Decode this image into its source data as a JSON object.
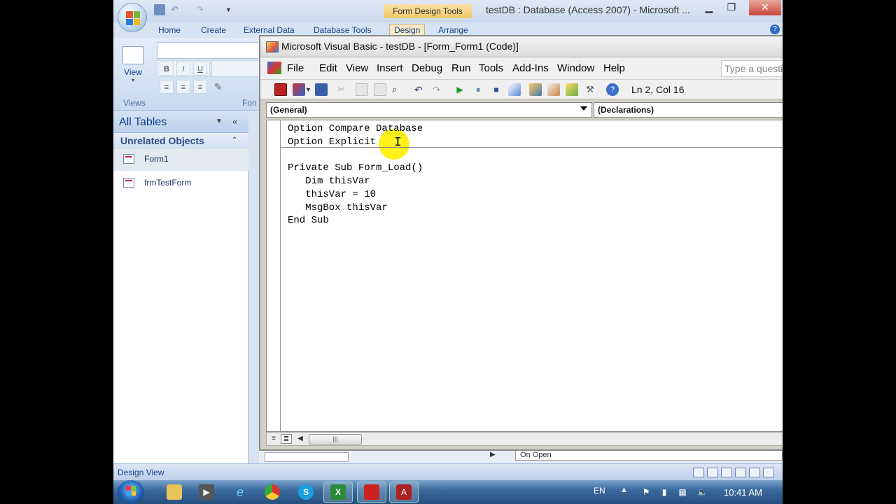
{
  "access": {
    "context_tab": "Form Design Tools",
    "title": "testDB : Database (Access 2007) - Microsoft ...",
    "tabs": [
      "Home",
      "Create",
      "External Data",
      "Database Tools",
      "Design",
      "Arrange"
    ],
    "view_label": "View",
    "views_group": "Views",
    "font_group_partial": "Fon",
    "format_buttons": [
      "B",
      "I",
      "U"
    ],
    "status_text": "Design View",
    "property_row": "On Open"
  },
  "nav_pane": {
    "title": "All Tables",
    "group": "Unrelated Objects",
    "items": [
      "Form1",
      "frmTestForm"
    ]
  },
  "vbe": {
    "title": "Microsoft Visual Basic - testDB - [Form_Form1 (Code)]",
    "menu": [
      "File",
      "Edit",
      "View",
      "Insert",
      "Debug",
      "Run",
      "Tools",
      "Add-Ins",
      "Window",
      "Help"
    ],
    "help_placeholder": "Type a questi",
    "position": "Ln 2, Col 16",
    "object_combo": "(General)",
    "proc_combo": "(Declarations)",
    "code": [
      "Option Compare Database",
      "Option Explicit",
      "",
      "Private Sub Form_Load()",
      "   Dim thisVar",
      "   thisVar = 10",
      "   MsgBox thisVar",
      "End Sub"
    ]
  },
  "taskbar": {
    "language": "EN",
    "time": "10:41 AM"
  }
}
